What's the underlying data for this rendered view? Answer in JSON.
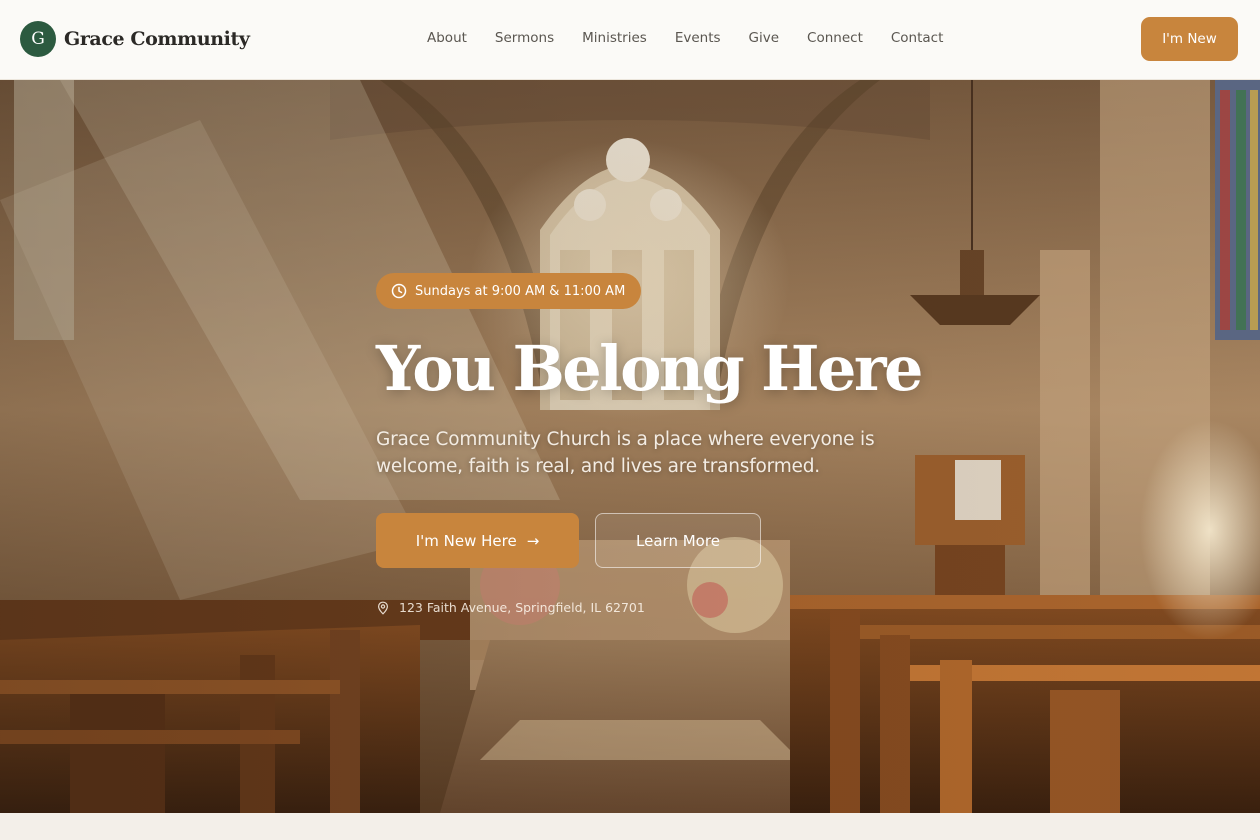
{
  "brand": {
    "initial": "G",
    "name": "Grace Community"
  },
  "nav": {
    "items": [
      "About",
      "Sermons",
      "Ministries",
      "Events",
      "Give",
      "Connect",
      "Contact"
    ],
    "cta": "I'm New"
  },
  "hero": {
    "badge_text": "Sundays at 9:00 AM & 11:00 AM",
    "title": "You Belong Here",
    "subtitle": "Grace Community Church is a place where everyone is welcome, faith is real, and lives are transformed.",
    "primary_cta": "I'm New Here",
    "secondary_cta": "Learn More",
    "address": "123 Faith Avenue, Springfield, IL 62701"
  },
  "colors": {
    "accent": "#c8853d",
    "brand_green": "#2c5a40",
    "nav_bg": "#fbfaf7",
    "page_bg": "#f3efe9"
  },
  "icons": {
    "badge": "clock-icon",
    "primary_cta": "arrow-right-icon",
    "address": "map-pin-icon"
  }
}
